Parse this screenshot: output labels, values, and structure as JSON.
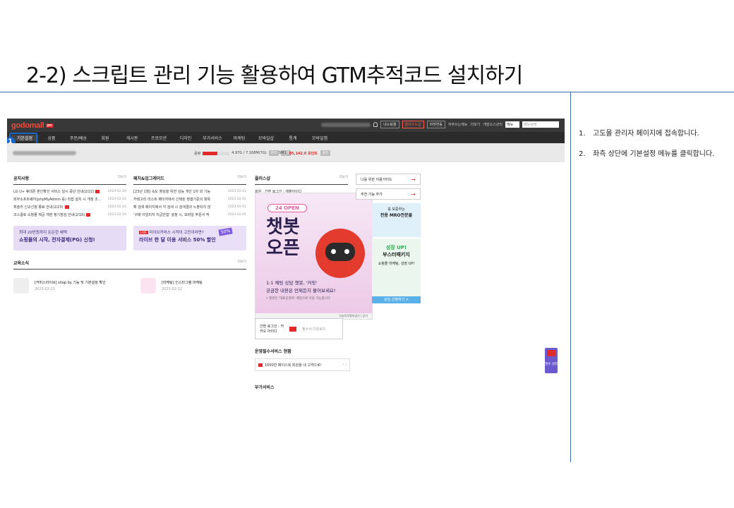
{
  "slide": {
    "title": "2-2) 스크립트 관리 기능 활용하여 GTM추적코드 설치하기",
    "steps": [
      {
        "num": "1.",
        "text": "고도몰 관리자 페이지에 접속합니다."
      },
      {
        "num": "2.",
        "text": "좌측 상단에 기본설정 메뉴를 클릭합니다."
      }
    ],
    "callout_number": "1"
  },
  "topbar": {
    "logo": "godomall",
    "logo_badge": "pro",
    "buttons": [
      "내소핑몰",
      "클라우드샵",
      "마켓연동"
    ],
    "links": [
      "자주쓰는메뉴",
      "더보기",
      "개발소스관리"
    ],
    "select": "메뉴",
    "search_placeholder": "메뉴검색"
  },
  "menu": [
    "기본설정",
    "상품",
    "주문/배송",
    "회원",
    "게시판",
    "프로모션",
    "디자인",
    "부가서비스",
    "마케팅",
    "모바일샵",
    "통계",
    "모바일앱"
  ],
  "infobar": {
    "capacity_label": "용량",
    "capacity_value": "4.97G / 7.168M(7G)",
    "capacity_ratio": 0.55,
    "buttons": [
      "관리",
      "추가"
    ],
    "sms_label": "SMS",
    "sms_points": "85,142.0 포인트",
    "sms_btn": "충전"
  },
  "notice": {
    "title": "공지사항",
    "more": "더보기",
    "rows": [
      {
        "t": "LG U+ 휴대폰 본인확인 서비스 일시 중단 안내(2/22)",
        "d": "2023-02-20",
        "new": true
      },
      {
        "t": "외부소프트웨어(phpMyAdmin 등) 직접 설치 시 개정 조...",
        "d": "2023-02-16",
        "new": false
      },
      {
        "t": "휘슬러 신규신청 종료 안내(2/23)",
        "d": "2023-02-16",
        "new": true
      },
      {
        "t": "코스콤로 쇼핑몰 제공 개편 정기점검 안내(2/16)",
        "d": "2023-02-16",
        "new": true
      }
    ]
  },
  "update": {
    "title": "패치&업그레이드",
    "more": "더보기",
    "rows": [
      {
        "t": "[23년 1월] 속도 향상을 위한 성능 개선 1차 외 기능",
        "d": "2023-02-01"
      },
      {
        "t": "카테고리 리스트 페이지에서 신택된 정렬기준의 항목",
        "d": "2023-02-01"
      },
      {
        "t": "확 검색 페이지에서 각 검색 시 검색결과 노출되지 않",
        "d": "2023-02-01"
      },
      {
        "t": "'구매 아일리지 지급안함' 설정 시, 모바일 주문서 적",
        "d": "2023-02-01"
      }
    ]
  },
  "plus": {
    "title": "플러스샵",
    "more": "더보기",
    "row": "회원 · 간편 로그인 : 애플아이디"
  },
  "banner1": {
    "small": "최대 20만원까지 든든한 혜택",
    "big": "쇼핑몰의 시작, 전자결제(PG) 신청!"
  },
  "banner2": {
    "small": "라이브커머스 시작이 고민이라면?",
    "big": "라이브 한 달 이용 서비스 50% 할인",
    "tag": "LIVE",
    "pct": "50%"
  },
  "edu": {
    "title": "교육소식",
    "more": "더보기",
    "items": [
      {
        "t": "[커머스라이브] shop by 기능 및 기본설정 확인",
        "d": "2023-02-21"
      },
      {
        "t": "[마케팅] 인스타그램 마케팅",
        "d": "2023-02-22"
      }
    ]
  },
  "popup": {
    "pill": "24 OPEN",
    "title": "챗봇 오픈",
    "sub1": "1:1 채팅 상담 챗봇, '커밋'",
    "sub2": "궁금한 내용은 언제든지 물어보세요!",
    "note": "• 챗봇은 '대표운영자' 계정으로 이용 가능합니다",
    "foot1": "오늘하루열지않기",
    "foot2": "닫기"
  },
  "side": {
    "btn1": "나를 위한 이용가이드",
    "btn2": "추천 기능 추가",
    "ad1a": "를 보증하는",
    "ad1b": "전용 MRO전문몰",
    "ad2a": "성장 UP!",
    "ad2b": "부스터패키지",
    "ad2c": "쇼핑몰 마케팅, 성장 UP!",
    "ad2d": "상담 신청하기 >"
  },
  "simple_login": {
    "label1": "간편 로그인 : 카",
    "label2": "카오 아이디",
    "right": "필수서 다운로드"
  },
  "ops": {
    "title": "운영필수서비스 현황",
    "row": "1600만 페이스북 회원을 내 고객으로!"
  },
  "extra": {
    "title": "부가서비스"
  },
  "quick": {
    "label": "필수 설정"
  }
}
